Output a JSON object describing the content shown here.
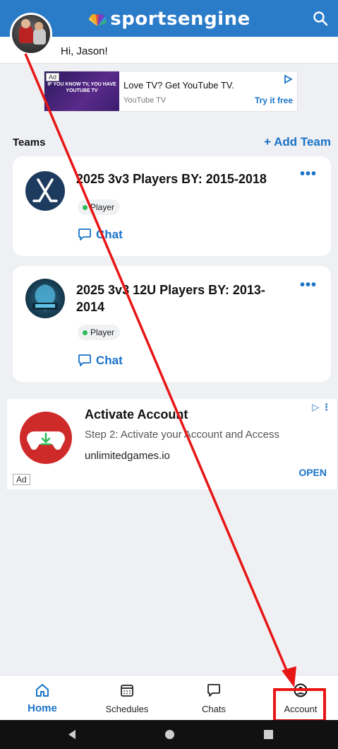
{
  "header": {
    "brand": "sportsengine"
  },
  "greeting": "Hi, Jason!",
  "ad_top": {
    "tag": "Ad",
    "image_text": "IF YOU KNOW TV, YOU HAVE YOUTUBE TV",
    "headline": "Love TV? Get YouTube TV.",
    "advertiser": "YouTube TV",
    "cta": "Try it free"
  },
  "teams": {
    "label": "Teams",
    "add_label": "+ Add Team",
    "items": [
      {
        "name": "2025 3v3 Players BY: 2015-2018",
        "role": "Player",
        "chat_label": "Chat",
        "more": "•••"
      },
      {
        "name": "2025 3v3 12U Players BY: 2013-2014",
        "role": "Player",
        "chat_label": "Chat",
        "more": "•••"
      }
    ]
  },
  "ad_bottom": {
    "title": "Activate Account",
    "description": "Step 2: Activate your Account and Access",
    "domain": "unlimitedgames.io",
    "cta": "OPEN",
    "tag": "Ad"
  },
  "tabs": [
    {
      "label": "Home",
      "active": true
    },
    {
      "label": "Schedules",
      "active": false
    },
    {
      "label": "Chats",
      "active": false
    },
    {
      "label": "Account",
      "active": false
    }
  ],
  "colors": {
    "brand": "#2a7bc8",
    "accent": "#1a73c8",
    "annotation": "#e81515",
    "status_green": "#2ebd58"
  }
}
